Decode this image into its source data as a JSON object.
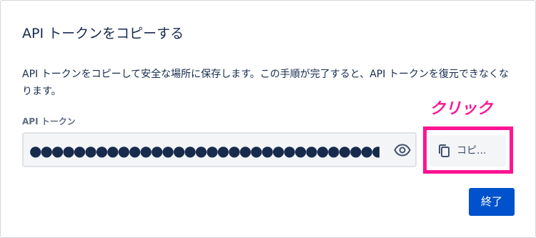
{
  "dialog": {
    "title": "API トークンをコピーする",
    "description": "API トークンをコピーして安全な場所に保存します。この手順が完了すると、API トークンを復元できなくなります。",
    "field_label": "API トークン",
    "token_masked": "●●●●●●●●●●●●●●●●●●●●●●●●●●●●●●●●●●●●●●●●●●●●●",
    "copy_label": "コピ...",
    "done_label": "終了"
  },
  "annotation": {
    "text": "クリック",
    "color": "#ff1493"
  },
  "icons": {
    "reveal": "eye-icon",
    "copy": "copy-icon"
  },
  "colors": {
    "primary": "#0052cc",
    "text": "#172b4d",
    "label": "#5e6c84"
  }
}
